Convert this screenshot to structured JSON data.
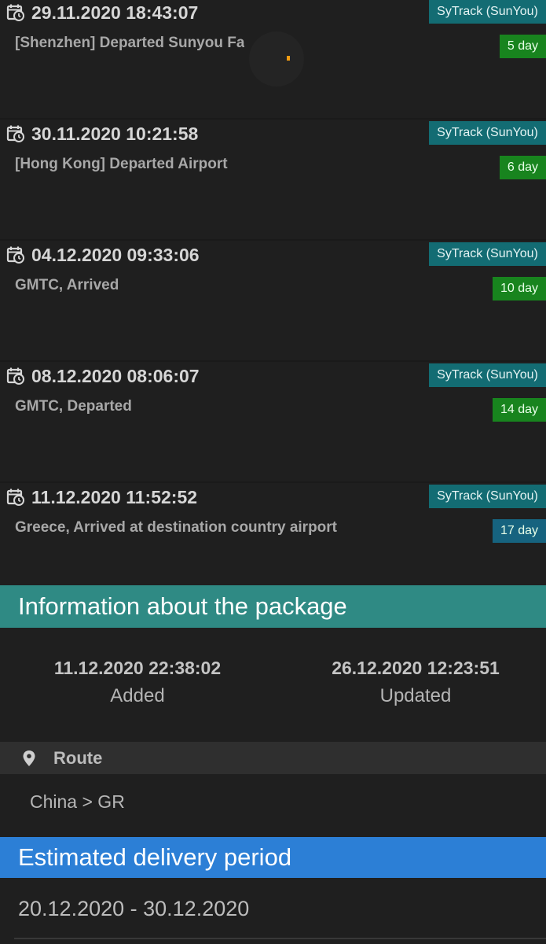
{
  "events": [
    {
      "datetime": "29.11.2020 18:43:07",
      "description": "[Shenzhen] Departed Sunyou Fa",
      "source": "SyTrack (SunYou)",
      "days": "5 day",
      "day_color": "green"
    },
    {
      "datetime": "30.11.2020 10:21:58",
      "description": "[Hong Kong] Departed Airport",
      "source": "SyTrack (SunYou)",
      "days": "6 day",
      "day_color": "green"
    },
    {
      "datetime": "04.12.2020 09:33:06",
      "description": "GMTC, Arrived",
      "source": "SyTrack (SunYou)",
      "days": "10 day",
      "day_color": "green"
    },
    {
      "datetime": "08.12.2020 08:06:07",
      "description": "GMTC, Departed",
      "source": "SyTrack (SunYou)",
      "days": "14 day",
      "day_color": "green"
    },
    {
      "datetime": "11.12.2020 11:52:52",
      "description": "Greece, Arrived at destination country airport",
      "source": "SyTrack (SunYou)",
      "days": "17 day",
      "day_color": "blue"
    }
  ],
  "package_info": {
    "title": "Information about the package",
    "added_value": "11.12.2020 22:38:02",
    "added_label": "Added",
    "updated_value": "26.12.2020 12:23:51",
    "updated_label": "Updated",
    "header_color": "#2f8a84"
  },
  "route": {
    "title": "Route",
    "value": "China > GR",
    "icon": "location-pin-icon"
  },
  "delivery": {
    "title": "Estimated delivery period",
    "value": "20.12.2020 - 30.12.2020",
    "header_color": "#2c7fd6"
  },
  "colors": {
    "source_badge": "#136c73",
    "day_green": "#18841e",
    "day_blue": "#16637f",
    "loading_spinner": "#f39c12"
  }
}
